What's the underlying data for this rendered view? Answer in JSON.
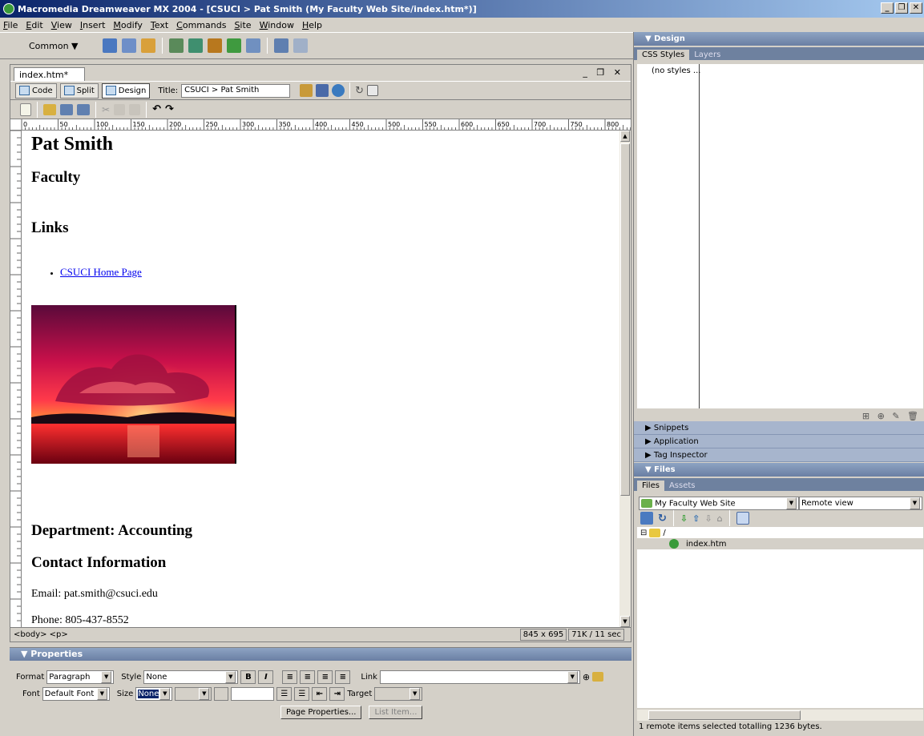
{
  "window": {
    "title": "Macromedia Dreamweaver MX 2004 - [CSUCI > Pat Smith (My Faculty Web Site/index.htm*)]"
  },
  "menu": [
    "File",
    "Edit",
    "View",
    "Insert",
    "Modify",
    "Text",
    "Commands",
    "Site",
    "Window",
    "Help"
  ],
  "insert_bar": {
    "category": "Common"
  },
  "document": {
    "tab": "index.htm*",
    "view_buttons": {
      "code": "Code",
      "split": "Split",
      "design": "Design"
    },
    "title_label": "Title:",
    "title_value": "CSUCI > Pat Smith",
    "ruler_marks": [
      "0",
      "50",
      "100",
      "150",
      "200",
      "250",
      "300",
      "350",
      "400",
      "450",
      "500",
      "550",
      "600",
      "650",
      "700",
      "750",
      "800"
    ],
    "status": {
      "tags": "<body> <p>",
      "size": "845 x 695",
      "download": "71K / 11 sec"
    }
  },
  "page": {
    "name": "Pat Smith",
    "role": "Faculty",
    "links_heading": "Links",
    "link_text": "CSUCI Home Page",
    "department": "Department: Accounting",
    "contact_heading": "Contact Information",
    "email": "Email: pat.smith@csuci.edu",
    "phone": "Phone: 805-437-8552"
  },
  "properties": {
    "header": "Properties",
    "format_label": "Format",
    "format_value": "Paragraph",
    "style_label": "Style",
    "style_value": "None",
    "link_label": "Link",
    "font_label": "Font",
    "font_value": "Default Font",
    "size_label": "Size",
    "size_value": "None",
    "target_label": "Target",
    "page_properties_button": "Page Properties...",
    "list_item_button": "List Item..."
  },
  "right_panels": {
    "design_header": "Design",
    "css_tab": "CSS Styles",
    "layers_tab": "Layers",
    "no_styles": "(no styles ...",
    "snippets": "Snippets",
    "application": "Application",
    "tag_inspector": "Tag Inspector",
    "files_header": "Files",
    "files_tab": "Files",
    "assets_tab": "Assets",
    "site": "My Faculty Web Site",
    "view": "Remote view",
    "tree_root": "/",
    "tree_file": "index.htm",
    "status": "1 remote items selected totalling 1236 bytes."
  }
}
